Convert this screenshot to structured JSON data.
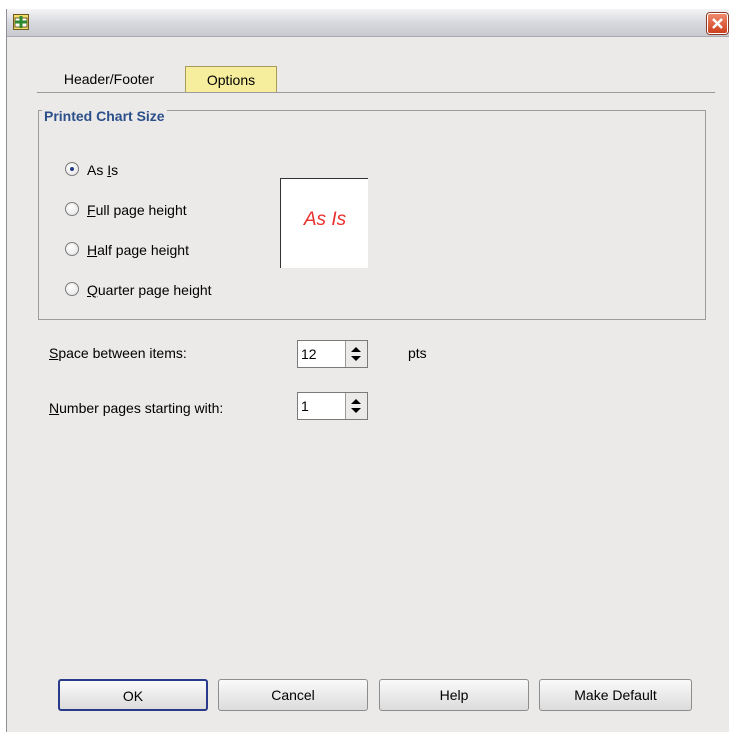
{
  "window": {
    "title": "",
    "close_icon": "close-icon"
  },
  "tabs": [
    {
      "label": "Header/Footer",
      "active": false
    },
    {
      "label": "Options",
      "active": true
    }
  ],
  "printed_chart_size": {
    "legend": "Printed Chart Size",
    "options": [
      {
        "pre": "As ",
        "key": "I",
        "post": "s",
        "checked": true
      },
      {
        "pre": "",
        "key": "F",
        "post": "ull page height",
        "checked": false
      },
      {
        "pre": "",
        "key": "H",
        "post": "alf page height",
        "checked": false
      },
      {
        "pre": "",
        "key": "Q",
        "post": "uarter page height",
        "checked": false
      }
    ],
    "preview_text": "As Is"
  },
  "space_between_items": {
    "key": "S",
    "label_rest": "pace between items:",
    "value": "12",
    "unit": "pts"
  },
  "number_pages": {
    "key": "N",
    "label_rest": "umber pages starting with:",
    "value": "1"
  },
  "buttons": {
    "ok": "OK",
    "cancel": "Cancel",
    "help": "Help",
    "make_default": "Make Default"
  },
  "colors": {
    "active_tab": "#f6ee9c",
    "legend_text": "#2b4f8a",
    "preview_text": "#e8302f",
    "close_button": "#cc3f1e"
  }
}
